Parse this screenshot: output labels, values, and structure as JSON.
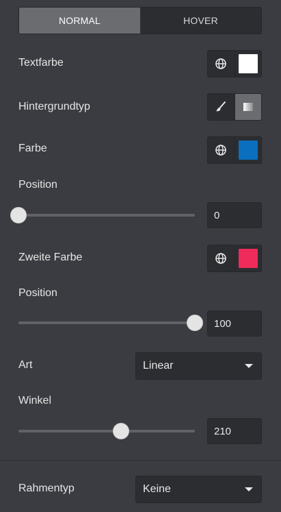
{
  "tabs": [
    {
      "label": "NORMAL",
      "active": true
    },
    {
      "label": "HOVER",
      "active": false
    }
  ],
  "text_color": {
    "label": "Textfarbe",
    "icon": "globe-icon",
    "swatch": "#ffffff"
  },
  "background_type": {
    "label": "Hintergrundtyp",
    "options": [
      "brush-icon",
      "gradient-icon"
    ],
    "active": "gradient-icon"
  },
  "color": {
    "label": "Farbe",
    "icon": "globe-icon",
    "swatch": "#0b6fbf"
  },
  "position1": {
    "label": "Position",
    "value": "0",
    "fraction": 0.0
  },
  "second_color": {
    "label": "Zweite Farbe",
    "icon": "globe-icon",
    "swatch": "#ee2b5a"
  },
  "position2": {
    "label": "Position",
    "value": "100",
    "fraction": 1.0
  },
  "type": {
    "label": "Art",
    "selected": "Linear"
  },
  "angle": {
    "label": "Winkel",
    "value": "210",
    "fraction": 0.583
  },
  "border_type": {
    "label": "Rahmentyp",
    "selected": "Keine"
  }
}
